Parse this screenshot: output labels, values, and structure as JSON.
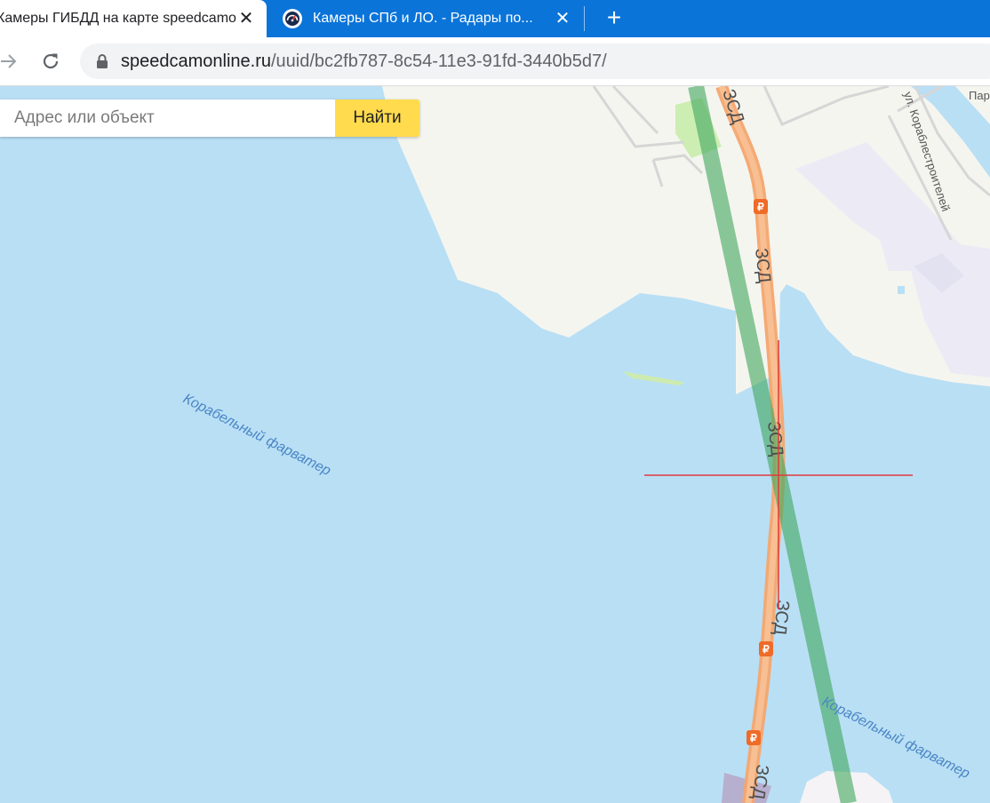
{
  "tabs": [
    {
      "title": "Камеры ГИБДД на карте speedcamonline",
      "close": "✕",
      "active": true
    },
    {
      "title": "Камеры СПб и ЛО. - Радары по...",
      "close": "✕",
      "active": false
    }
  ],
  "newtab_symbol": "+",
  "address": {
    "host": "speedcamonline.ru",
    "path": "/uuid/bc2fb787-8c54-11e3-91fd-3440b5d7/"
  },
  "search": {
    "placeholder": "Адрес или объект",
    "button_label": "Найти"
  },
  "map": {
    "road_label": "ЗСД",
    "toll_symbol": "₽",
    "fairway_label": "Корабельный фарватер",
    "street_label": "ул. Кораблестроителей",
    "partial_label": "Пар",
    "colors": {
      "water": "#b9dff5",
      "land": "#f5f5ef",
      "road": "#f7b07a",
      "fairway": "#5fb16f",
      "crosshair": "#e03a3a"
    }
  },
  "icons": [
    "back-arrow-icon",
    "reload-icon",
    "lock-icon",
    "speedometer-favicon-icon",
    "toll-icon"
  ]
}
